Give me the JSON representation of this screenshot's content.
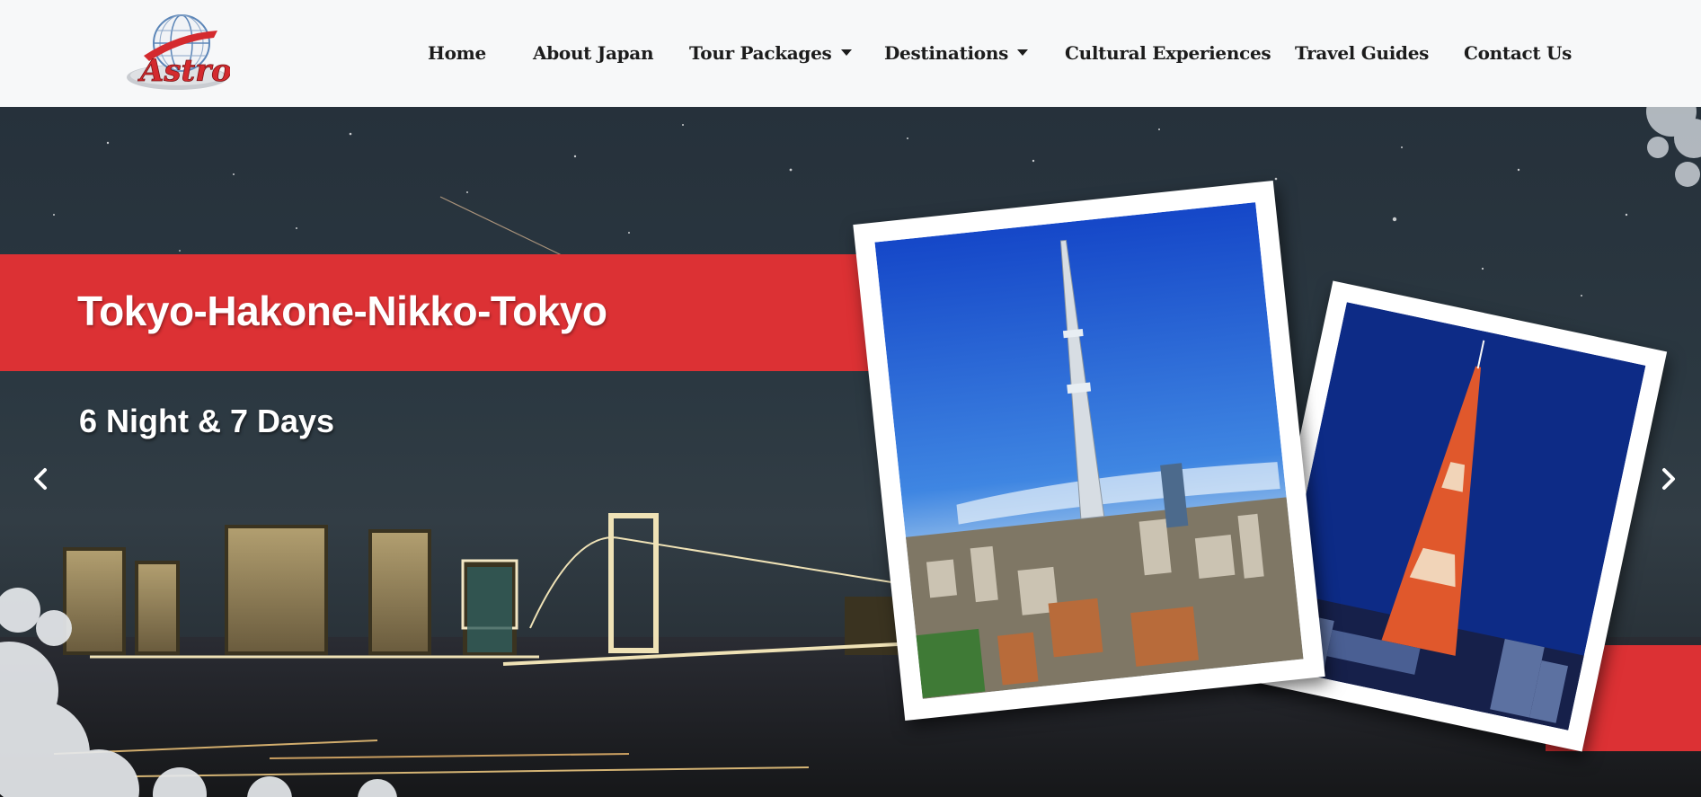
{
  "brand": {
    "logo_text": "Astro",
    "logo_color": "#d42a2e"
  },
  "nav": {
    "items": [
      {
        "label": "Home",
        "dropdown": false
      },
      {
        "label": "About Japan",
        "dropdown": false
      },
      {
        "label": "Tour Packages",
        "dropdown": true
      },
      {
        "label": "Destinations",
        "dropdown": true
      },
      {
        "label": "Cultural Experiences",
        "dropdown": false
      },
      {
        "label": "Travel Guides",
        "dropdown": false
      },
      {
        "label": "Contact Us",
        "dropdown": false
      }
    ]
  },
  "hero": {
    "title": "Tokyo-Hakone-Nikko-Tokyo",
    "subtitle": "6 Night & 7 Days",
    "accent_color": "#dc3134",
    "prev_icon": "chevron-left-icon",
    "next_icon": "chevron-right-icon"
  }
}
